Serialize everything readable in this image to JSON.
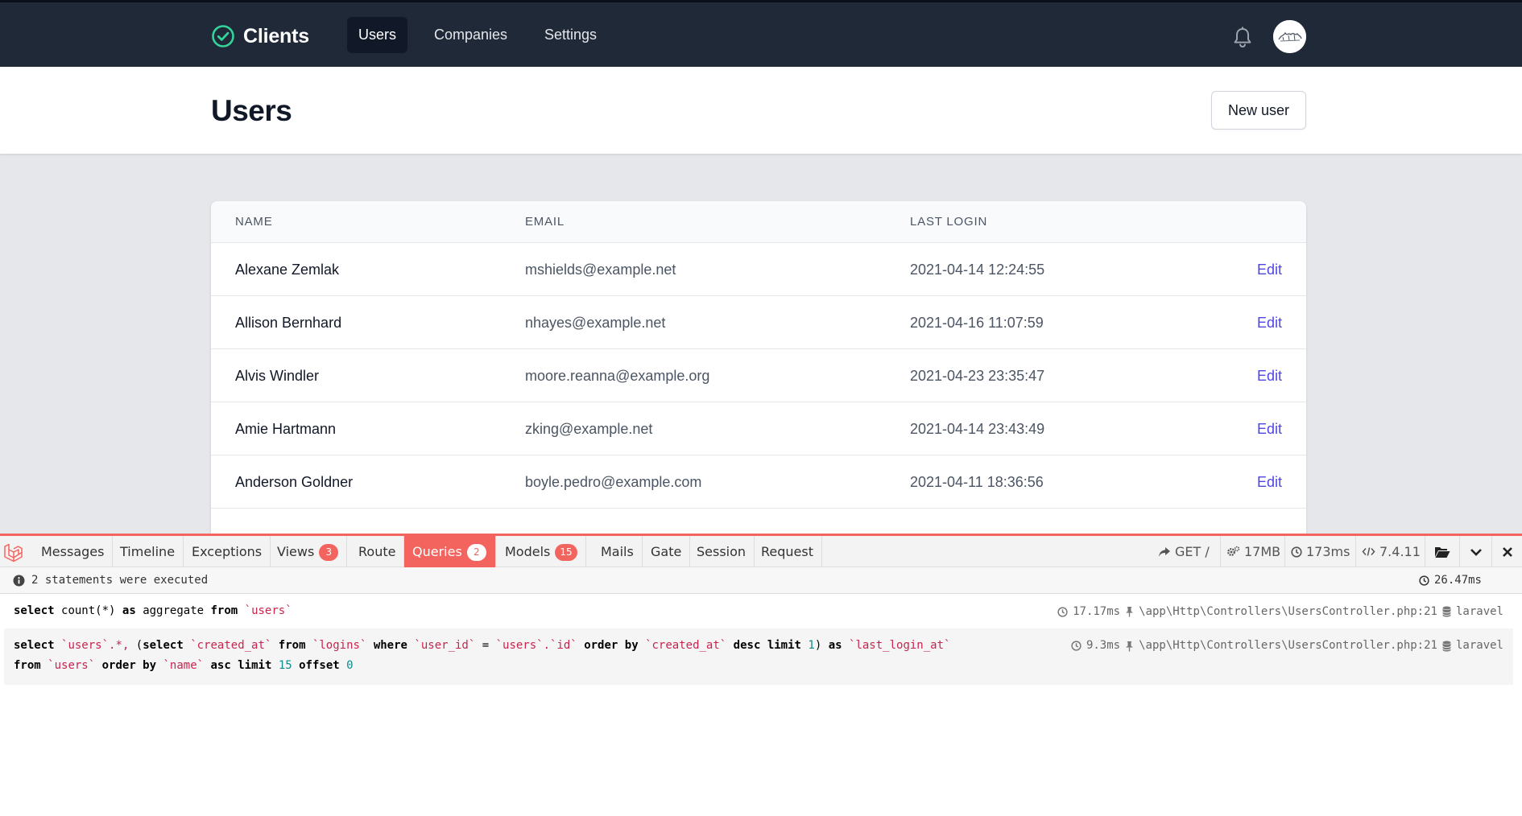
{
  "app": {
    "brand": "Clients",
    "nav": [
      {
        "label": "Users",
        "active": true
      },
      {
        "label": "Companies",
        "active": false
      },
      {
        "label": "Settings",
        "active": false
      }
    ],
    "icons": {
      "brand": "check-circle-icon",
      "notifications": "bell-icon"
    }
  },
  "header": {
    "title": "Users",
    "new_button": "New user"
  },
  "table": {
    "columns": [
      "NAME",
      "EMAIL",
      "LAST LOGIN",
      ""
    ],
    "rows": [
      {
        "name": "Alexane Zemlak",
        "email": "mshields@example.net",
        "last_login": "2021-04-14 12:24:55",
        "action": "Edit"
      },
      {
        "name": "Allison Bernhard",
        "email": "nhayes@example.net",
        "last_login": "2021-04-16 11:07:59",
        "action": "Edit"
      },
      {
        "name": "Alvis Windler",
        "email": "moore.reanna@example.org",
        "last_login": "2021-04-23 23:35:47",
        "action": "Edit"
      },
      {
        "name": "Amie Hartmann",
        "email": "zking@example.net",
        "last_login": "2021-04-14 23:43:49",
        "action": "Edit"
      },
      {
        "name": "Anderson Goldner",
        "email": "boyle.pedro@example.com",
        "last_login": "2021-04-11 18:36:56",
        "action": "Edit"
      }
    ]
  },
  "debugbar": {
    "tabs": [
      {
        "label": "Messages"
      },
      {
        "label": "Timeline"
      },
      {
        "label": "Exceptions"
      },
      {
        "label": "Views",
        "badge": "3"
      },
      {
        "label": "Route"
      },
      {
        "label": "Queries",
        "badge": "2",
        "active": true
      },
      {
        "label": "Models",
        "badge": "15"
      },
      {
        "label": "Mails"
      },
      {
        "label": "Gate"
      },
      {
        "label": "Session"
      },
      {
        "label": "Request"
      }
    ],
    "status": {
      "method": "GET /",
      "memory": "17MB",
      "time": "173ms",
      "php_version": "7.4.11"
    },
    "summary": {
      "statements": "2 statements were executed",
      "total_time": "26.47ms"
    },
    "queries": [
      {
        "time": "17.17ms",
        "source": "\\app\\Http\\Controllers\\UsersController.php:21",
        "connection": "laravel"
      },
      {
        "time": "9.3ms",
        "source": "\\app\\Http\\Controllers\\UsersController.php:21",
        "connection": "laravel"
      }
    ],
    "sql": {
      "kw_select": "select",
      "kw_as": "as",
      "kw_from": "from",
      "kw_where": "where",
      "kw_order_by": "order by",
      "kw_desc": "desc",
      "kw_limit": "limit",
      "kw_asc": "asc",
      "kw_offset": "offset",
      "count_expr": "count(*)",
      "aggregate": "aggregate",
      "t_users": "`users`",
      "t_users_star": "`users`.*,",
      "t_logins": "`logins`",
      "c_created_at": "`created_at`",
      "c_user_id": "`user_id`",
      "c_users_id": "`users`.`id`",
      "c_last_login_at": "`last_login_at`",
      "c_name": "`name`",
      "eq": "=",
      "paren_open": "(",
      "paren_close": ")",
      "n1": "1",
      "n15": "15",
      "n0": "0"
    }
  }
}
